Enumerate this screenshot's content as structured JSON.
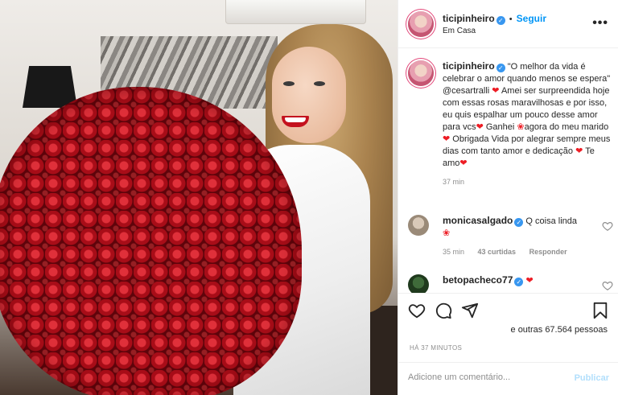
{
  "post": {
    "username": "ticipinheiro",
    "follow_label": "Seguir",
    "dot": "•",
    "location": "Em Casa",
    "more": "•••"
  },
  "caption": {
    "username": "ticipinheiro",
    "text_1": "\"O melhor da vida é celebrar o amor quando menos se espera\" @cesartralli",
    "text_2": "Amei ser surpreendida hoje com essas rosas maravilhosas e por isso, eu quis espalhar um pouco desse amor para vcs",
    "text_3": "Ganhei",
    "text_4": "agora do meu marido",
    "text_5": "Obrigada Vida por alegrar sempre meus dias com tanto amor e dedicação",
    "text_6": "Te amo",
    "time": "37 min"
  },
  "comments": [
    {
      "username": "monicasalgado",
      "text": "Q coisa linda",
      "time": "35 min",
      "likes": "43 curtidas",
      "reply": "Responder"
    },
    {
      "username": "betopacheco77",
      "text": ""
    }
  ],
  "likes_text": "e outras 67.564 pessoas",
  "time_ago": "HÁ 37 MINUTOS",
  "add_comment_placeholder": "Adicione um comentário...",
  "publish_label": "Publicar",
  "colors": {
    "accent": "#0095f6",
    "heart": "#ed1c24",
    "verified": "#3897f0",
    "muted": "#8e8e8e"
  },
  "icons": [
    "heart-icon",
    "comment-icon",
    "share-icon",
    "bookmark-icon",
    "verified-icon",
    "more-icon"
  ]
}
